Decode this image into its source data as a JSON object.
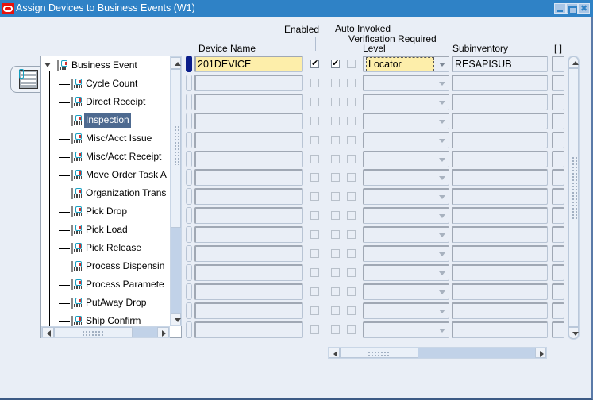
{
  "window": {
    "title": "Assign Devices to Business Events (W1)",
    "controls": [
      "minimize",
      "maximize",
      "close"
    ]
  },
  "tree": {
    "root": "Business Event",
    "items": [
      {
        "label": "Cycle Count",
        "selected": false
      },
      {
        "label": "Direct Receipt",
        "selected": false
      },
      {
        "label": "Inspection",
        "selected": true
      },
      {
        "label": "Misc/Acct Issue",
        "selected": false
      },
      {
        "label": "Misc/Acct Receipt",
        "selected": false
      },
      {
        "label": "Move Order Task A",
        "selected": false
      },
      {
        "label": "Organization Trans",
        "selected": false
      },
      {
        "label": "Pick Drop",
        "selected": false
      },
      {
        "label": "Pick Load",
        "selected": false
      },
      {
        "label": "Pick Release",
        "selected": false
      },
      {
        "label": "Process Dispensin",
        "selected": false
      },
      {
        "label": "Process Paramete",
        "selected": false
      },
      {
        "label": "PutAway Drop",
        "selected": false
      },
      {
        "label": "Ship Confirm",
        "selected": false
      }
    ]
  },
  "grid": {
    "headers": {
      "device_name": "Device Name",
      "enabled": "Enabled",
      "auto_invoked": "Auto Invoked",
      "verification_required": "Verification Required",
      "level": "Level",
      "subinventory": "Subinventory",
      "extra": "[ ]"
    },
    "rows": [
      {
        "device_name": "201DEVICE",
        "enabled": true,
        "auto_invoked": true,
        "verification_required": false,
        "level": "Locator",
        "subinventory": "RESAPISUB"
      },
      {
        "device_name": "",
        "enabled": false,
        "auto_invoked": false,
        "verification_required": false,
        "level": "",
        "subinventory": ""
      },
      {
        "device_name": "",
        "enabled": false,
        "auto_invoked": false,
        "verification_required": false,
        "level": "",
        "subinventory": ""
      },
      {
        "device_name": "",
        "enabled": false,
        "auto_invoked": false,
        "verification_required": false,
        "level": "",
        "subinventory": ""
      },
      {
        "device_name": "",
        "enabled": false,
        "auto_invoked": false,
        "verification_required": false,
        "level": "",
        "subinventory": ""
      },
      {
        "device_name": "",
        "enabled": false,
        "auto_invoked": false,
        "verification_required": false,
        "level": "",
        "subinventory": ""
      },
      {
        "device_name": "",
        "enabled": false,
        "auto_invoked": false,
        "verification_required": false,
        "level": "",
        "subinventory": ""
      },
      {
        "device_name": "",
        "enabled": false,
        "auto_invoked": false,
        "verification_required": false,
        "level": "",
        "subinventory": ""
      },
      {
        "device_name": "",
        "enabled": false,
        "auto_invoked": false,
        "verification_required": false,
        "level": "",
        "subinventory": ""
      },
      {
        "device_name": "",
        "enabled": false,
        "auto_invoked": false,
        "verification_required": false,
        "level": "",
        "subinventory": ""
      },
      {
        "device_name": "",
        "enabled": false,
        "auto_invoked": false,
        "verification_required": false,
        "level": "",
        "subinventory": ""
      },
      {
        "device_name": "",
        "enabled": false,
        "auto_invoked": false,
        "verification_required": false,
        "level": "",
        "subinventory": ""
      },
      {
        "device_name": "",
        "enabled": false,
        "auto_invoked": false,
        "verification_required": false,
        "level": "",
        "subinventory": ""
      },
      {
        "device_name": "",
        "enabled": false,
        "auto_invoked": false,
        "verification_required": false,
        "level": "",
        "subinventory": ""
      },
      {
        "device_name": "",
        "enabled": false,
        "auto_invoked": false,
        "verification_required": false,
        "level": "",
        "subinventory": ""
      }
    ]
  },
  "icons": {
    "app_logo": "oracle-logo-icon",
    "tree_toggle": "tree-navigator-icon",
    "tree_node": "business-event-node-icon"
  },
  "colors": {
    "titlebar": "#2f82c6",
    "selection": "#4e6a90",
    "current_record": "#fdeeaa",
    "row_indicator": "#0a1d8a"
  }
}
